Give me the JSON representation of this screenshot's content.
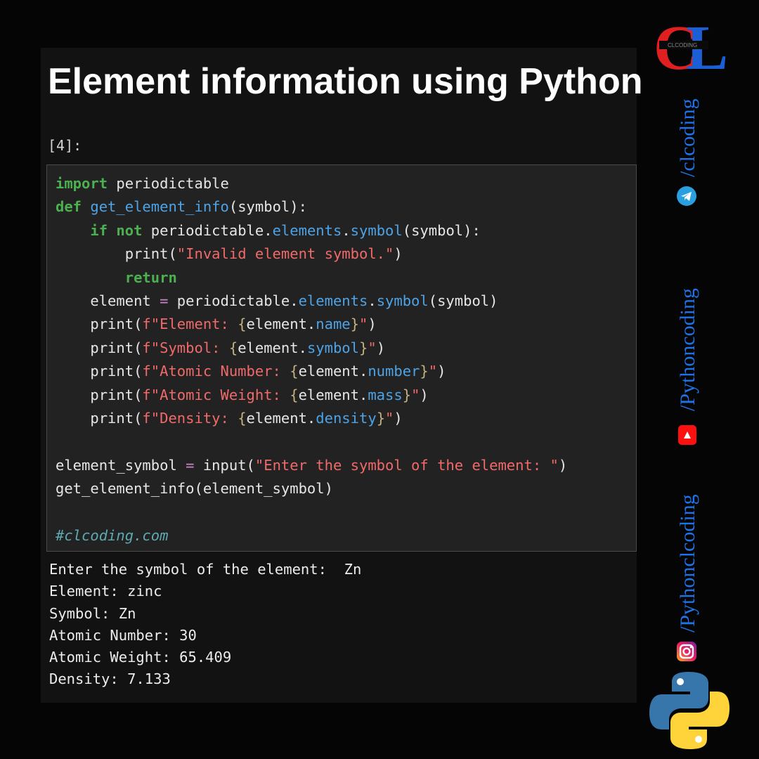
{
  "title": "Element information using Python",
  "cell_prompt": "[4]:",
  "code_lines": [
    [
      {
        "t": "import",
        "c": "kw"
      },
      {
        "t": " periodictable",
        "c": ""
      }
    ],
    [
      {
        "t": "def",
        "c": "kw"
      },
      {
        "t": " ",
        "c": ""
      },
      {
        "t": "get_element_info",
        "c": "fn"
      },
      {
        "t": "(symbol):",
        "c": ""
      }
    ],
    [
      {
        "t": "    ",
        "c": ""
      },
      {
        "t": "if",
        "c": "kw"
      },
      {
        "t": " ",
        "c": ""
      },
      {
        "t": "not",
        "c": "kw"
      },
      {
        "t": " periodictable.",
        "c": ""
      },
      {
        "t": "elements",
        "c": "attr"
      },
      {
        "t": ".",
        "c": ""
      },
      {
        "t": "symbol",
        "c": "attr"
      },
      {
        "t": "(symbol):",
        "c": ""
      }
    ],
    [
      {
        "t": "        print(",
        "c": ""
      },
      {
        "t": "\"Invalid element symbol.\"",
        "c": "str"
      },
      {
        "t": ")",
        "c": ""
      }
    ],
    [
      {
        "t": "        ",
        "c": ""
      },
      {
        "t": "return",
        "c": "kw"
      }
    ],
    [
      {
        "t": "    element ",
        "c": ""
      },
      {
        "t": "=",
        "c": "op"
      },
      {
        "t": " periodictable.",
        "c": ""
      },
      {
        "t": "elements",
        "c": "attr"
      },
      {
        "t": ".",
        "c": ""
      },
      {
        "t": "symbol",
        "c": "attr"
      },
      {
        "t": "(symbol)",
        "c": ""
      }
    ],
    [
      {
        "t": "    print(",
        "c": ""
      },
      {
        "t": "f\"Element: ",
        "c": "str"
      },
      {
        "t": "{",
        "c": "brace"
      },
      {
        "t": "element.",
        "c": ""
      },
      {
        "t": "name",
        "c": "attr"
      },
      {
        "t": "}",
        "c": "brace"
      },
      {
        "t": "\"",
        "c": "str"
      },
      {
        "t": ")",
        "c": ""
      }
    ],
    [
      {
        "t": "    print(",
        "c": ""
      },
      {
        "t": "f\"Symbol: ",
        "c": "str"
      },
      {
        "t": "{",
        "c": "brace"
      },
      {
        "t": "element.",
        "c": ""
      },
      {
        "t": "symbol",
        "c": "attr"
      },
      {
        "t": "}",
        "c": "brace"
      },
      {
        "t": "\"",
        "c": "str"
      },
      {
        "t": ")",
        "c": ""
      }
    ],
    [
      {
        "t": "    print(",
        "c": ""
      },
      {
        "t": "f\"Atomic Number: ",
        "c": "str"
      },
      {
        "t": "{",
        "c": "brace"
      },
      {
        "t": "element.",
        "c": ""
      },
      {
        "t": "number",
        "c": "attr"
      },
      {
        "t": "}",
        "c": "brace"
      },
      {
        "t": "\"",
        "c": "str"
      },
      {
        "t": ")",
        "c": ""
      }
    ],
    [
      {
        "t": "    print(",
        "c": ""
      },
      {
        "t": "f\"Atomic Weight: ",
        "c": "str"
      },
      {
        "t": "{",
        "c": "brace"
      },
      {
        "t": "element.",
        "c": ""
      },
      {
        "t": "mass",
        "c": "attr"
      },
      {
        "t": "}",
        "c": "brace"
      },
      {
        "t": "\"",
        "c": "str"
      },
      {
        "t": ")",
        "c": ""
      }
    ],
    [
      {
        "t": "    print(",
        "c": ""
      },
      {
        "t": "f\"Density: ",
        "c": "str"
      },
      {
        "t": "{",
        "c": "brace"
      },
      {
        "t": "element.",
        "c": ""
      },
      {
        "t": "density",
        "c": "attr"
      },
      {
        "t": "}",
        "c": "brace"
      },
      {
        "t": "\"",
        "c": "str"
      },
      {
        "t": ")",
        "c": ""
      }
    ],
    [
      {
        "t": "",
        "c": ""
      }
    ],
    [
      {
        "t": "element_symbol ",
        "c": ""
      },
      {
        "t": "=",
        "c": "op"
      },
      {
        "t": " input(",
        "c": ""
      },
      {
        "t": "\"Enter the symbol of the element: \"",
        "c": "str"
      },
      {
        "t": ")",
        "c": ""
      }
    ],
    [
      {
        "t": "get_element_info(element_symbol)",
        "c": ""
      }
    ],
    [
      {
        "t": "",
        "c": ""
      }
    ],
    [
      {
        "t": "#clcoding.com",
        "c": "cm"
      }
    ]
  ],
  "output_lines": [
    "Enter the symbol of the element:  Zn",
    "Element: zinc",
    "Symbol: Zn",
    "Atomic Number: 30",
    "Atomic Weight: 65.409",
    "Density: 7.133"
  ],
  "sidebar": {
    "logo_letters": {
      "c": "C",
      "l": "L"
    },
    "logo_band_text": "CLCODING",
    "handles": [
      {
        "label": "/clcoding",
        "icon": "telegram-icon"
      },
      {
        "label": "/Pythoncoding",
        "icon": "youtube-icon"
      },
      {
        "label": "/Pythonclcoding",
        "icon": "instagram-icon"
      }
    ],
    "bottom_icon": "python-logo-icon"
  },
  "colors": {
    "background": "#050505",
    "panel": "#121212",
    "code_bg": "#222222",
    "keyword": "#4caf50",
    "function": "#4da3e6",
    "string": "#f06a6a",
    "comment": "#5fa9b3",
    "handle_text": "#1e73e8"
  }
}
